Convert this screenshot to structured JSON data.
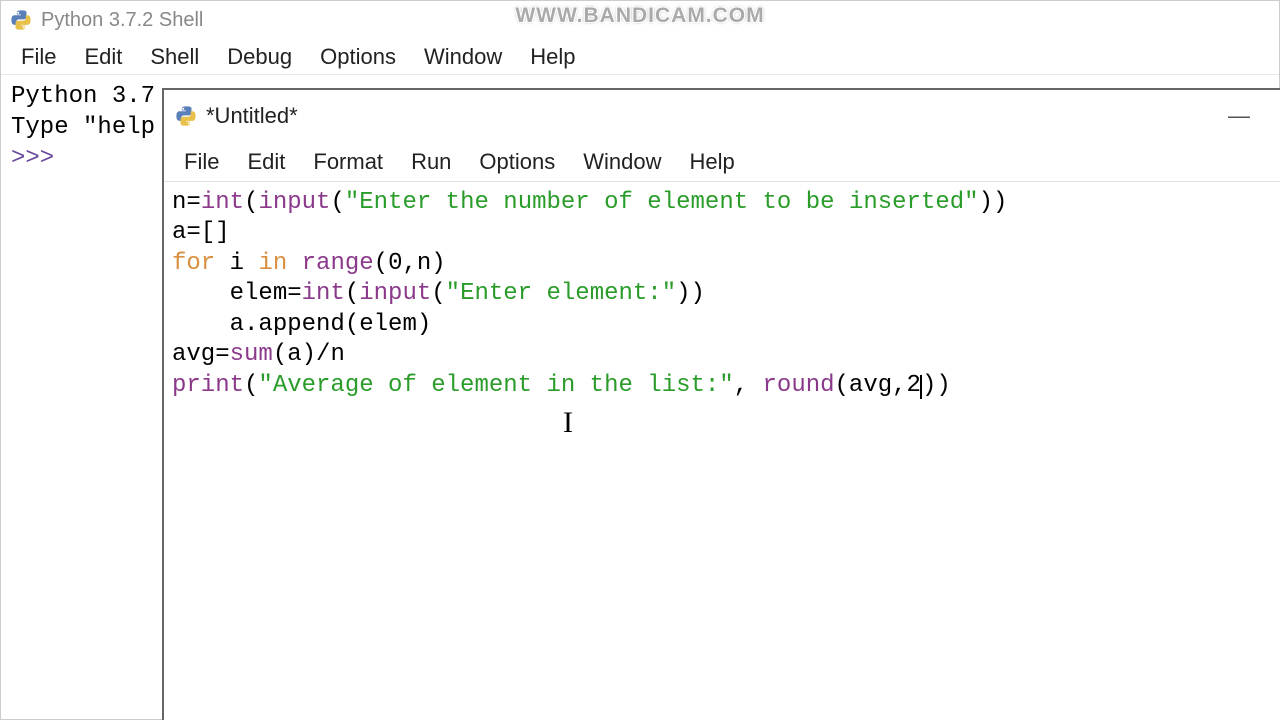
{
  "watermark": "WWW.BANDICAM.COM",
  "shell": {
    "title": "Python 3.7.2 Shell",
    "menu": [
      "File",
      "Edit",
      "Shell",
      "Debug",
      "Options",
      "Window",
      "Help"
    ],
    "line1": "Python 3.7",
    "line2": "Type \"help",
    "prompt": ">>> "
  },
  "editor": {
    "title": "*Untitled*",
    "menu": [
      "File",
      "Edit",
      "Format",
      "Run",
      "Options",
      "Window",
      "Help"
    ],
    "code": {
      "l1_a": "n=",
      "l1_int": "int",
      "l1_b": "(",
      "l1_input": "input",
      "l1_c": "(",
      "l1_str": "\"Enter the number of element to be inserted\"",
      "l1_d": "))",
      "l2": "a=[]",
      "l3_for": "for",
      "l3_a": " i ",
      "l3_in": "in",
      "l3_b": " ",
      "l3_range": "range",
      "l3_c": "(0,n)",
      "l4_a": "    elem=",
      "l4_int": "int",
      "l4_b": "(",
      "l4_input": "input",
      "l4_c": "(",
      "l4_str": "\"Enter element:\"",
      "l4_d": "))",
      "l5": "    a.append(elem)",
      "l6_a": "avg=",
      "l6_sum": "sum",
      "l6_b": "(a)/n",
      "l7_print": "print",
      "l7_a": "(",
      "l7_str": "\"Average of element in the list:\"",
      "l7_b": ", ",
      "l7_round": "round",
      "l7_c": "(avg,2",
      "l7_d": "))"
    }
  }
}
